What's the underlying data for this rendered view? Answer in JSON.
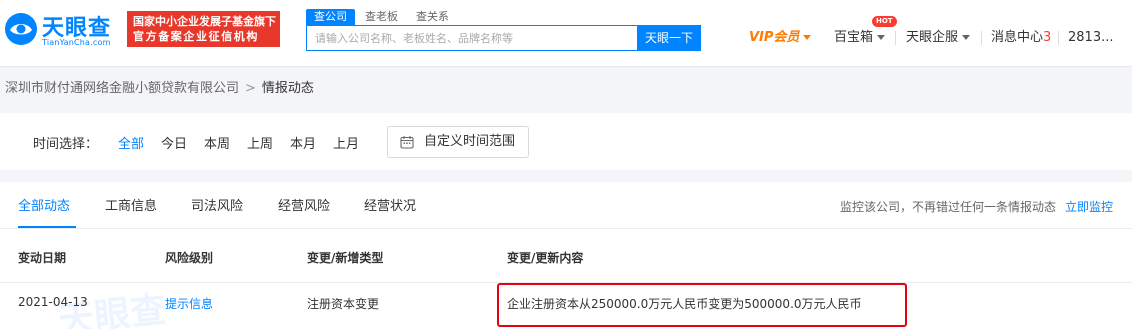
{
  "header": {
    "logo": {
      "name": "天眼查",
      "domain": "TianYanCha.com"
    },
    "banner": {
      "line1": "国家中小企业发展子基金旗下",
      "line2": "官方备案企业征信机构"
    },
    "search_tabs": [
      "查公司",
      "查老板",
      "查关系"
    ],
    "search_placeholder": "请输入公司名称、老板姓名、品牌名称等",
    "search_button": "天眼一下",
    "nav": {
      "vip": "VIP会员",
      "box": "百宝箱",
      "hot_badge": "HOT",
      "corp": "天眼企服",
      "msg": "消息中心",
      "msg_count": "3",
      "user": "2813..."
    },
    "colors": {
      "accent": "#0084ff",
      "banner": "#e8382c",
      "vip": "#ff7a00",
      "highlight_border": "#e60012"
    }
  },
  "breadcrumb": {
    "company": "深圳市财付通网络金融小额贷款有限公司",
    "separator": ">",
    "current": "情报动态"
  },
  "time_filter": {
    "label": "时间选择：",
    "options": [
      "全部",
      "今日",
      "本周",
      "上周",
      "本月",
      "上月"
    ],
    "selected": "全部",
    "custom_range": "自定义时间范围"
  },
  "tabs": {
    "items": [
      "全部动态",
      "工商信息",
      "司法风险",
      "经营风险",
      "经营状况"
    ],
    "active": "全部动态",
    "monitor_hint": "监控该公司，不再错过任何一条情报动态",
    "monitor_link": "立即监控"
  },
  "table": {
    "headers": [
      "变动日期",
      "风险级别",
      "变更/新增类型",
      "变更/更新内容"
    ],
    "rows": [
      {
        "date": "2021-04-13",
        "risk": "提示信息",
        "type": "注册资本变更",
        "content": "企业注册资本从250000.0万元人民币变更为500000.0万元人民币"
      }
    ]
  }
}
